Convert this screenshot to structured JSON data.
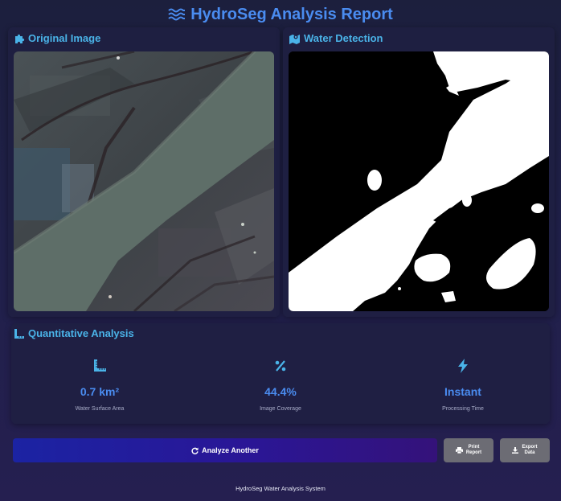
{
  "header": {
    "title": "HydroSeg Analysis Report",
    "icon": "water-waves-icon"
  },
  "original_panel": {
    "title": "Original Image",
    "icon": "puzzle-icon",
    "image": "satellite-river-image"
  },
  "detection_panel": {
    "title": "Water Detection",
    "icon": "map-marked-icon",
    "image": "water-mask-image"
  },
  "analysis": {
    "title": "Quantitative Analysis",
    "icon": "ruler-combined-icon",
    "metrics": [
      {
        "icon": "ruler-icon",
        "value": "0.7 km²",
        "label": "Water Surface Area"
      },
      {
        "icon": "percent-icon",
        "value": "44.4%",
        "label": "Image Coverage"
      },
      {
        "icon": "bolt-icon",
        "value": "Instant",
        "label": "Processing Time"
      }
    ]
  },
  "actions": {
    "analyze_label": "Analyze Another",
    "print_label_1": "Print",
    "print_label_2": "Report",
    "export_label_1": "Export",
    "export_label_2": "Data"
  },
  "footer": {
    "text": "HydroSeg Water Analysis System"
  },
  "colors": {
    "accent": "#4a8cf0",
    "section": "#4ab3e8",
    "button_gray": "#6c6c74"
  }
}
